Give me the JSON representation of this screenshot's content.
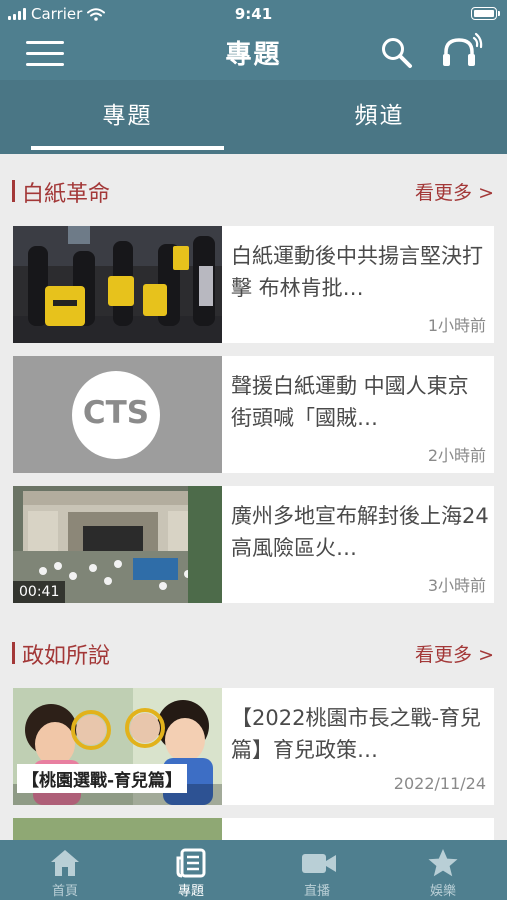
{
  "status_bar": {
    "carrier": "Carrier",
    "time": "9:41"
  },
  "header": {
    "title": "專題",
    "menu_icon": "hamburger-menu-icon",
    "search_icon": "search-icon",
    "audio_icon": "headphones-icon"
  },
  "tabs": [
    {
      "label": "專題",
      "selected": true
    },
    {
      "label": "頻道",
      "selected": false
    }
  ],
  "sections": [
    {
      "title": "白紙革命",
      "see_more": "看更多 >",
      "items": [
        {
          "title": "白紙運動後中共揚言堅決打擊 布林肯批…",
          "time": "1小時前"
        },
        {
          "title": "聲援白紙運動 中國人東京街頭喊「國賊…",
          "time": "2小時前",
          "thumb_text": "CTS"
        },
        {
          "title": "廣州多地宣布解封後上海24高風險區火…",
          "time": "3小時前",
          "duration": "00:41"
        }
      ]
    },
    {
      "title": "政如所說",
      "see_more": "看更多 >",
      "items": [
        {
          "title": "【2022桃園市長之戰-育兒篇】育兒政策…",
          "time": "2022/11/24",
          "thumb_caption": "【桃園選戰-育兒篇】"
        }
      ]
    }
  ],
  "bottom_nav": [
    {
      "label": "首頁",
      "icon": "home-icon",
      "active": false
    },
    {
      "label": "專題",
      "icon": "newspaper-icon",
      "active": true
    },
    {
      "label": "直播",
      "icon": "video-camera-icon",
      "active": false
    },
    {
      "label": "娛樂",
      "icon": "star-icon",
      "active": false
    }
  ],
  "colors": {
    "header_bg": "#4f7f8f",
    "tab_bg": "#4a7685",
    "accent": "#a33838",
    "page_bg": "#ececec"
  }
}
